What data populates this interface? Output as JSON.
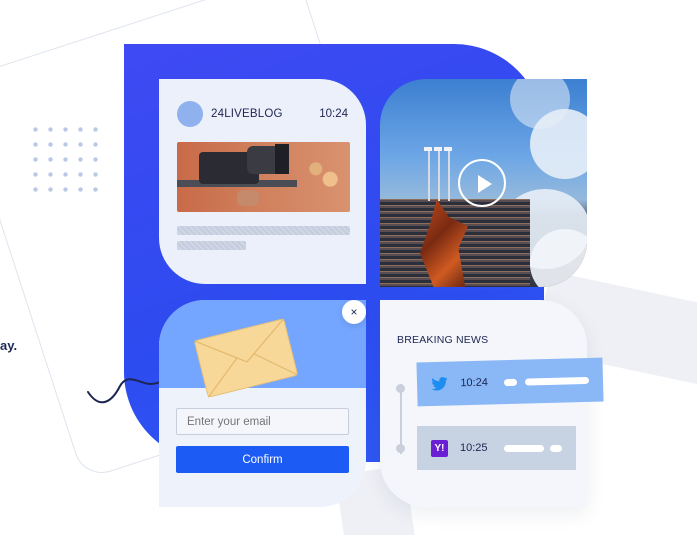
{
  "side_text": "ay.",
  "live_card": {
    "brand": "24LIVEBLOG",
    "time": "10:24"
  },
  "email_card": {
    "placeholder": "Enter your email",
    "confirm_label": "Confirm",
    "close_symbol": "×"
  },
  "breaking_card": {
    "title": "BREAKING NEWS",
    "items": [
      {
        "source_icon": "twitter-icon",
        "time": "10:24"
      },
      {
        "source_icon": "yahoo-icon",
        "time": "10:25",
        "logo_text": "Y!"
      }
    ]
  },
  "colors": {
    "panel_blue": "#3f4af3",
    "email_header": "#74a6ff",
    "confirm_button": "#1c5cf5",
    "twitter_item": "#8ab7f6",
    "yahoo_item": "#c7d2e3",
    "text_dark": "#1d2552"
  }
}
